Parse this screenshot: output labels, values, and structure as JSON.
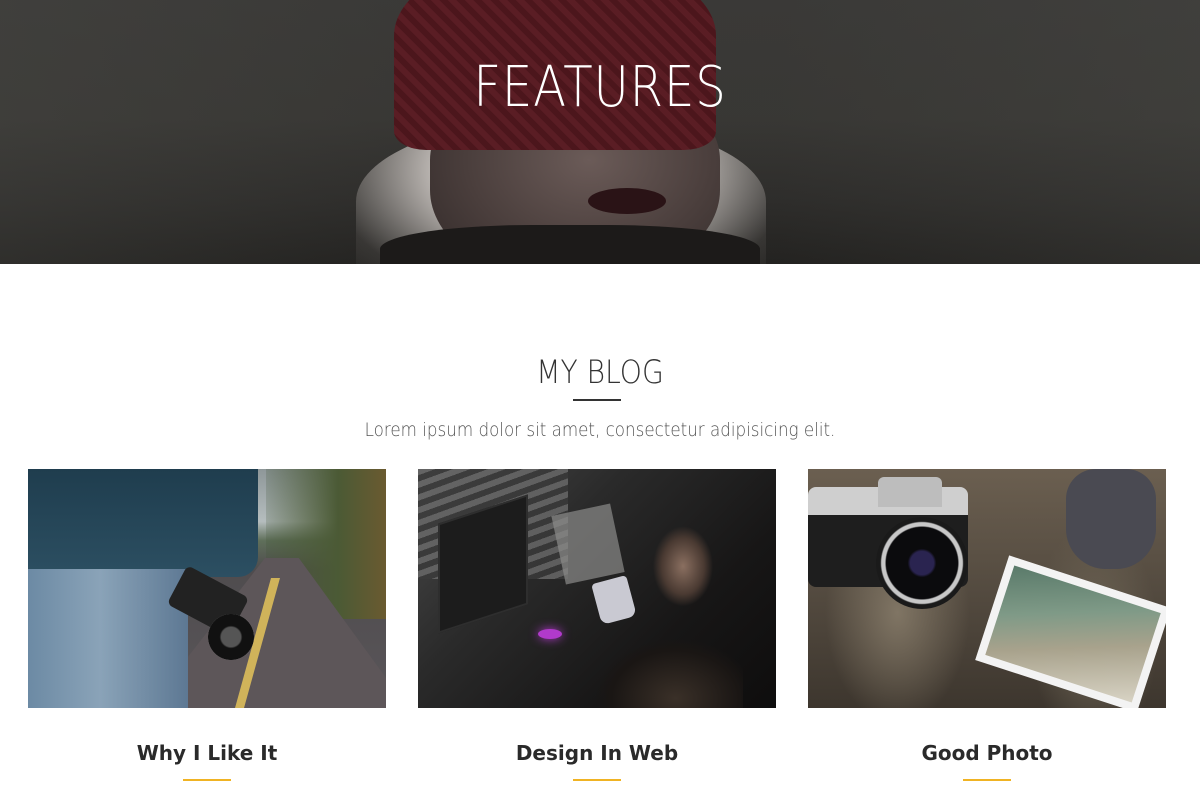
{
  "hero": {
    "title": "FEATURES"
  },
  "section": {
    "title": "MY BLOG",
    "subtitle": "Lorem ipsum dolor sit amet, consectetur adipisicing elit."
  },
  "colors": {
    "accent": "#f0b323",
    "text": "#2a2a2a"
  },
  "posts": [
    {
      "title": "Why I Like It"
    },
    {
      "title": "Design In Web"
    },
    {
      "title": "Good Photo"
    }
  ]
}
